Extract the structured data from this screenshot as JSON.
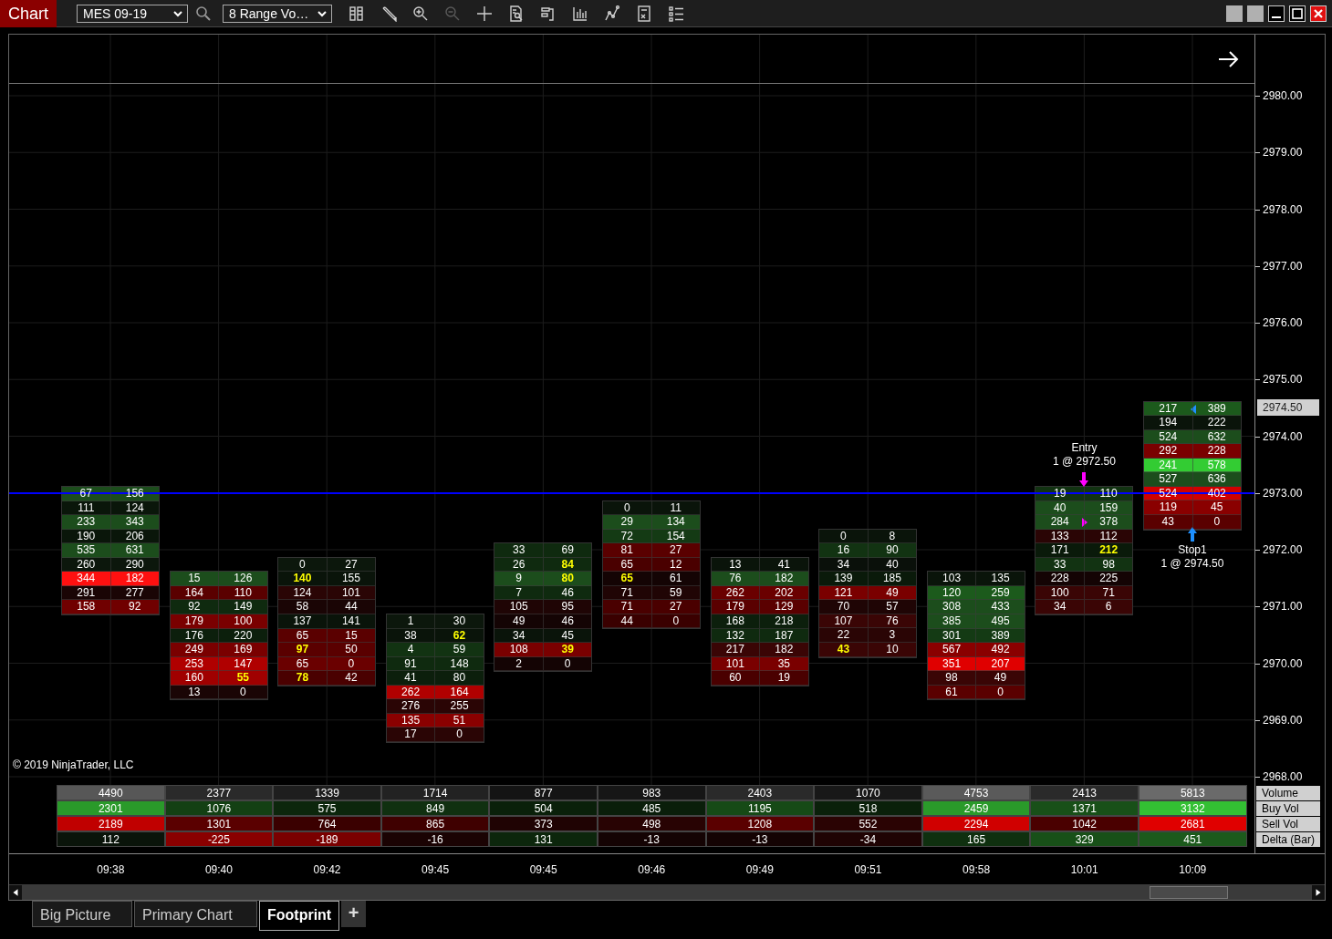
{
  "toolbar": {
    "title": "Chart",
    "instrument": "MES 09-19",
    "interval": "8 Range Vo…",
    "tools": [
      {
        "kind": "columns",
        "disabled": false
      },
      {
        "kind": "pencil",
        "disabled": false
      },
      {
        "kind": "zoom-in",
        "disabled": false
      },
      {
        "kind": "zoom-out",
        "disabled": true
      },
      {
        "kind": "crosshair",
        "disabled": false
      },
      {
        "kind": "doc-search",
        "disabled": false
      },
      {
        "kind": "bracket",
        "disabled": false
      },
      {
        "kind": "bars",
        "disabled": false
      },
      {
        "kind": "line",
        "disabled": false
      },
      {
        "kind": "calc",
        "disabled": false
      },
      {
        "kind": "list",
        "disabled": false
      }
    ]
  },
  "price_axis": {
    "labels": [
      "2980.00",
      "2979.00",
      "2978.00",
      "2977.00",
      "2976.00",
      "2975.00",
      "2974.00",
      "2973.00",
      "2972.00",
      "2971.00",
      "2970.00",
      "2969.00",
      "2968.00"
    ],
    "current": "2974.50"
  },
  "bars": [
    {
      "rows": [
        {
          "bid": "67",
          "ask": "156",
          "color": "#1c4d1c",
          "bid_imbalance": false,
          "ask_imbalance": false
        },
        {
          "bid": "111",
          "ask": "124",
          "color": "#0a160a",
          "bid_imbalance": false,
          "ask_imbalance": false
        },
        {
          "bid": "233",
          "ask": "343",
          "color": "#1c4d1c",
          "bid_imbalance": false,
          "ask_imbalance": false
        },
        {
          "bid": "190",
          "ask": "206",
          "color": "#0a160a",
          "bid_imbalance": false,
          "ask_imbalance": false
        },
        {
          "bid": "535",
          "ask": "631",
          "color": "#1c4d1c",
          "bid_imbalance": false,
          "ask_imbalance": false
        },
        {
          "bid": "260",
          "ask": "290",
          "color": "#0c170c",
          "bid_imbalance": false,
          "ask_imbalance": false
        },
        {
          "bid": "344",
          "ask": "182",
          "color": "#ff1010",
          "bid_imbalance": false,
          "ask_imbalance": false
        },
        {
          "bid": "291",
          "ask": "277",
          "color": "#1a0505",
          "bid_imbalance": false,
          "ask_imbalance": false
        },
        {
          "bid": "158",
          "ask": "92",
          "color": "#700000",
          "bid_imbalance": false,
          "ask_imbalance": false
        }
      ]
    },
    {
      "rows": [
        {
          "bid": "15",
          "ask": "126",
          "color": "#1c4d1c",
          "bid_imbalance": false,
          "ask_imbalance": false
        },
        {
          "bid": "164",
          "ask": "110",
          "color": "#5a0000",
          "bid_imbalance": false,
          "ask_imbalance": false
        },
        {
          "bid": "92",
          "ask": "149",
          "color": "#0f2a0f",
          "bid_imbalance": false,
          "ask_imbalance": false
        },
        {
          "bid": "179",
          "ask": "100",
          "color": "#7a0000",
          "bid_imbalance": false,
          "ask_imbalance": false
        },
        {
          "bid": "176",
          "ask": "220",
          "color": "#0c1f0c",
          "bid_imbalance": false,
          "ask_imbalance": false
        },
        {
          "bid": "249",
          "ask": "169",
          "color": "#7a0000",
          "bid_imbalance": false,
          "ask_imbalance": false
        },
        {
          "bid": "253",
          "ask": "147",
          "color": "#b00000",
          "bid_imbalance": false,
          "ask_imbalance": false
        },
        {
          "bid": "160",
          "ask": "55",
          "color": "#a00000",
          "bid_imbalance": false,
          "ask_imbalance": true
        },
        {
          "bid": "13",
          "ask": "0",
          "color": "#1a0505",
          "bid_imbalance": false,
          "ask_imbalance": false
        }
      ]
    },
    {
      "rows": [
        {
          "bid": "0",
          "ask": "27",
          "color": "#0c170c",
          "bid_imbalance": false,
          "ask_imbalance": false
        },
        {
          "bid": "140",
          "ask": "155",
          "color": "#0a140a",
          "bid_imbalance": true,
          "ask_imbalance": false
        },
        {
          "bid": "124",
          "ask": "101",
          "color": "#2a0505",
          "bid_imbalance": false,
          "ask_imbalance": false
        },
        {
          "bid": "58",
          "ask": "44",
          "color": "#1a0505",
          "bid_imbalance": false,
          "ask_imbalance": false
        },
        {
          "bid": "137",
          "ask": "141",
          "color": "#0a140a",
          "bid_imbalance": false,
          "ask_imbalance": false
        },
        {
          "bid": "65",
          "ask": "15",
          "color": "#5a0000",
          "bid_imbalance": false,
          "ask_imbalance": false
        },
        {
          "bid": "97",
          "ask": "50",
          "color": "#5a0000",
          "bid_imbalance": true,
          "ask_imbalance": false
        },
        {
          "bid": "65",
          "ask": "0",
          "color": "#6a0000",
          "bid_imbalance": false,
          "ask_imbalance": false
        },
        {
          "bid": "78",
          "ask": "42",
          "color": "#4a0000",
          "bid_imbalance": true,
          "ask_imbalance": false
        }
      ]
    },
    {
      "rows": [
        {
          "bid": "1",
          "ask": "30",
          "color": "#0c170c",
          "bid_imbalance": false,
          "ask_imbalance": false
        },
        {
          "bid": "38",
          "ask": "62",
          "color": "#0a140a",
          "bid_imbalance": false,
          "ask_imbalance": true
        },
        {
          "bid": "4",
          "ask": "59",
          "color": "#123312",
          "bid_imbalance": false,
          "ask_imbalance": false
        },
        {
          "bid": "91",
          "ask": "148",
          "color": "#0f2a0f",
          "bid_imbalance": false,
          "ask_imbalance": false
        },
        {
          "bid": "41",
          "ask": "80",
          "color": "#0c1f0c",
          "bid_imbalance": false,
          "ask_imbalance": false
        },
        {
          "bid": "262",
          "ask": "164",
          "color": "#b00000",
          "bid_imbalance": false,
          "ask_imbalance": false
        },
        {
          "bid": "276",
          "ask": "255",
          "color": "#2a0505",
          "bid_imbalance": false,
          "ask_imbalance": false
        },
        {
          "bid": "135",
          "ask": "51",
          "color": "#8a0000",
          "bid_imbalance": false,
          "ask_imbalance": false
        },
        {
          "bid": "17",
          "ask": "0",
          "color": "#2a0505",
          "bid_imbalance": false,
          "ask_imbalance": false
        }
      ]
    },
    {
      "rows": [
        {
          "bid": "33",
          "ask": "69",
          "color": "#0f2a0f",
          "bid_imbalance": false,
          "ask_imbalance": false
        },
        {
          "bid": "26",
          "ask": "84",
          "color": "#0f2a0f",
          "bid_imbalance": false,
          "ask_imbalance": true
        },
        {
          "bid": "9",
          "ask": "80",
          "color": "#1c4d1c",
          "bid_imbalance": false,
          "ask_imbalance": true
        },
        {
          "bid": "7",
          "ask": "46",
          "color": "#0f2a0f",
          "bid_imbalance": false,
          "ask_imbalance": false
        },
        {
          "bid": "105",
          "ask": "95",
          "color": "#1f0505",
          "bid_imbalance": false,
          "ask_imbalance": false
        },
        {
          "bid": "49",
          "ask": "46",
          "color": "#140404",
          "bid_imbalance": false,
          "ask_imbalance": false
        },
        {
          "bid": "34",
          "ask": "45",
          "color": "#0a140a",
          "bid_imbalance": false,
          "ask_imbalance": false
        },
        {
          "bid": "108",
          "ask": "39",
          "color": "#7a0000",
          "bid_imbalance": false,
          "ask_imbalance": true
        },
        {
          "bid": "2",
          "ask": "0",
          "color": "#140404",
          "bid_imbalance": false,
          "ask_imbalance": false
        }
      ]
    },
    {
      "rows": [
        {
          "bid": "0",
          "ask": "11",
          "color": "#0a140a",
          "bid_imbalance": false,
          "ask_imbalance": false
        },
        {
          "bid": "29",
          "ask": "134",
          "color": "#1c4d1c",
          "bid_imbalance": false,
          "ask_imbalance": false
        },
        {
          "bid": "72",
          "ask": "154",
          "color": "#143a14",
          "bid_imbalance": false,
          "ask_imbalance": false
        },
        {
          "bid": "81",
          "ask": "27",
          "color": "#5a0000",
          "bid_imbalance": false,
          "ask_imbalance": false
        },
        {
          "bid": "65",
          "ask": "12",
          "color": "#4a0000",
          "bid_imbalance": false,
          "ask_imbalance": false
        },
        {
          "bid": "65",
          "ask": "61",
          "color": "#140404",
          "bid_imbalance": true,
          "ask_imbalance": false
        },
        {
          "bid": "71",
          "ask": "59",
          "color": "#200505",
          "bid_imbalance": false,
          "ask_imbalance": false
        },
        {
          "bid": "71",
          "ask": "27",
          "color": "#4a0000",
          "bid_imbalance": false,
          "ask_imbalance": false
        },
        {
          "bid": "44",
          "ask": "0",
          "color": "#3a0000",
          "bid_imbalance": false,
          "ask_imbalance": false
        }
      ]
    },
    {
      "rows": [
        {
          "bid": "13",
          "ask": "41",
          "color": "#0a140a",
          "bid_imbalance": false,
          "ask_imbalance": false
        },
        {
          "bid": "76",
          "ask": "182",
          "color": "#1c4d1c",
          "bid_imbalance": false,
          "ask_imbalance": false
        },
        {
          "bid": "262",
          "ask": "202",
          "color": "#6a0000",
          "bid_imbalance": false,
          "ask_imbalance": false
        },
        {
          "bid": "179",
          "ask": "129",
          "color": "#5a0000",
          "bid_imbalance": false,
          "ask_imbalance": false
        },
        {
          "bid": "168",
          "ask": "218",
          "color": "#0c1f0c",
          "bid_imbalance": false,
          "ask_imbalance": false
        },
        {
          "bid": "132",
          "ask": "187",
          "color": "#0f2a0f",
          "bid_imbalance": false,
          "ask_imbalance": false
        },
        {
          "bid": "217",
          "ask": "182",
          "color": "#3a0505",
          "bid_imbalance": false,
          "ask_imbalance": false
        },
        {
          "bid": "101",
          "ask": "35",
          "color": "#7a0000",
          "bid_imbalance": false,
          "ask_imbalance": false
        },
        {
          "bid": "60",
          "ask": "19",
          "color": "#4a0000",
          "bid_imbalance": false,
          "ask_imbalance": false
        }
      ]
    },
    {
      "rows": [
        {
          "bid": "0",
          "ask": "8",
          "color": "#0a140a",
          "bid_imbalance": false,
          "ask_imbalance": false
        },
        {
          "bid": "16",
          "ask": "90",
          "color": "#123312",
          "bid_imbalance": false,
          "ask_imbalance": false
        },
        {
          "bid": "34",
          "ask": "40",
          "color": "#0a100a",
          "bid_imbalance": false,
          "ask_imbalance": false
        },
        {
          "bid": "139",
          "ask": "185",
          "color": "#0a1a0a",
          "bid_imbalance": false,
          "ask_imbalance": false
        },
        {
          "bid": "121",
          "ask": "49",
          "color": "#7a0000",
          "bid_imbalance": false,
          "ask_imbalance": false
        },
        {
          "bid": "70",
          "ask": "57",
          "color": "#1f0505",
          "bid_imbalance": false,
          "ask_imbalance": false
        },
        {
          "bid": "107",
          "ask": "76",
          "color": "#3a0505",
          "bid_imbalance": false,
          "ask_imbalance": false
        },
        {
          "bid": "22",
          "ask": "3",
          "color": "#2a0505",
          "bid_imbalance": false,
          "ask_imbalance": false
        },
        {
          "bid": "43",
          "ask": "10",
          "color": "#3a0505",
          "bid_imbalance": true,
          "ask_imbalance": false
        }
      ]
    },
    {
      "rows": [
        {
          "bid": "103",
          "ask": "135",
          "color": "#0a140a",
          "bid_imbalance": false,
          "ask_imbalance": false
        },
        {
          "bid": "120",
          "ask": "259",
          "color": "#1c5a1c",
          "bid_imbalance": false,
          "ask_imbalance": false
        },
        {
          "bid": "308",
          "ask": "433",
          "color": "#1c4d1c",
          "bid_imbalance": false,
          "ask_imbalance": false
        },
        {
          "bid": "385",
          "ask": "495",
          "color": "#1c4d1c",
          "bid_imbalance": false,
          "ask_imbalance": false
        },
        {
          "bid": "301",
          "ask": "389",
          "color": "#143a14",
          "bid_imbalance": false,
          "ask_imbalance": false
        },
        {
          "bid": "567",
          "ask": "492",
          "color": "#8a0000",
          "bid_imbalance": false,
          "ask_imbalance": false
        },
        {
          "bid": "351",
          "ask": "207",
          "color": "#e00000",
          "bid_imbalance": false,
          "ask_imbalance": false
        },
        {
          "bid": "98",
          "ask": "49",
          "color": "#3a0505",
          "bid_imbalance": false,
          "ask_imbalance": false
        },
        {
          "bid": "61",
          "ask": "0",
          "color": "#5a0000",
          "bid_imbalance": false,
          "ask_imbalance": false
        }
      ]
    },
    {
      "order": {
        "kind": "entry",
        "label": "Entry",
        "detail": "1 @ 2972.50"
      },
      "rows": [
        {
          "bid": "19",
          "ask": "110",
          "color": "#123312",
          "bid_imbalance": false,
          "ask_imbalance": false
        },
        {
          "bid": "40",
          "ask": "159",
          "color": "#1c4d1c",
          "bid_imbalance": false,
          "ask_imbalance": false
        },
        {
          "bid": "284",
          "ask": "378",
          "color": "#1c4d1c",
          "bid_imbalance": false,
          "ask_imbalance": false
        },
        {
          "bid": "133",
          "ask": "112",
          "color": "#2a0505",
          "bid_imbalance": false,
          "ask_imbalance": false
        },
        {
          "bid": "171",
          "ask": "212",
          "color": "#0a1a0a",
          "bid_imbalance": false,
          "ask_imbalance": true
        },
        {
          "bid": "33",
          "ask": "98",
          "color": "#123312",
          "bid_imbalance": false,
          "ask_imbalance": false
        },
        {
          "bid": "228",
          "ask": "225",
          "color": "#140404",
          "bid_imbalance": false,
          "ask_imbalance": false
        },
        {
          "bid": "100",
          "ask": "71",
          "color": "#3a0505",
          "bid_imbalance": false,
          "ask_imbalance": false
        },
        {
          "bid": "34",
          "ask": "6",
          "color": "#3a0505",
          "bid_imbalance": false,
          "ask_imbalance": false
        }
      ]
    },
    {
      "order": {
        "kind": "stop",
        "label": "Stop1",
        "detail": "1 @ 2974.50"
      },
      "rows": [
        {
          "bid": "217",
          "ask": "389",
          "color": "#1c5a1c",
          "bid_imbalance": false,
          "ask_imbalance": false
        },
        {
          "bid": "194",
          "ask": "222",
          "color": "#0a140a",
          "bid_imbalance": false,
          "ask_imbalance": false
        },
        {
          "bid": "524",
          "ask": "632",
          "color": "#1c4d1c",
          "bid_imbalance": false,
          "ask_imbalance": false
        },
        {
          "bid": "292",
          "ask": "228",
          "color": "#7a0000",
          "bid_imbalance": false,
          "ask_imbalance": false
        },
        {
          "bid": "241",
          "ask": "578",
          "color": "#33cc33",
          "bid_imbalance": false,
          "ask_imbalance": false
        },
        {
          "bid": "527",
          "ask": "636",
          "color": "#1c4d1c",
          "bid_imbalance": false,
          "ask_imbalance": false
        },
        {
          "bid": "524",
          "ask": "402",
          "color": "#d00000",
          "bid_imbalance": false,
          "ask_imbalance": false
        },
        {
          "bid": "119",
          "ask": "45",
          "color": "#8a0000",
          "bid_imbalance": false,
          "ask_imbalance": false
        },
        {
          "bid": "43",
          "ask": "0",
          "color": "#5a0000",
          "bid_imbalance": false,
          "ask_imbalance": false
        }
      ]
    }
  ],
  "summary": {
    "row_labels": [
      "Volume",
      "Buy Vol",
      "Sell Vol",
      "Delta (Bar)"
    ],
    "rows": [
      [
        {
          "text": "4490",
          "color": "#575757"
        },
        {
          "text": "2377",
          "color": "#2a2a2a"
        },
        {
          "text": "1339",
          "color": "#1e1e1e"
        },
        {
          "text": "1714",
          "color": "#222222"
        },
        {
          "text": "877",
          "color": "#141414"
        },
        {
          "text": "983",
          "color": "#161616"
        },
        {
          "text": "2403",
          "color": "#2a2a2a"
        },
        {
          "text": "1070",
          "color": "#181818"
        },
        {
          "text": "4753",
          "color": "#5a5a5a"
        },
        {
          "text": "2413",
          "color": "#2a2a2a"
        },
        {
          "text": "5813",
          "color": "#6a6a6a"
        }
      ],
      [
        {
          "text": "2301",
          "color": "#2a9a2a"
        },
        {
          "text": "1076",
          "color": "#134013"
        },
        {
          "text": "575",
          "color": "#0c260c"
        },
        {
          "text": "849",
          "color": "#103010"
        },
        {
          "text": "504",
          "color": "#0a200a"
        },
        {
          "text": "485",
          "color": "#0a1e0a"
        },
        {
          "text": "1195",
          "color": "#164a16"
        },
        {
          "text": "518",
          "color": "#0a200a"
        },
        {
          "text": "2459",
          "color": "#2a9a2a"
        },
        {
          "text": "1371",
          "color": "#185018"
        },
        {
          "text": "3132",
          "color": "#33c033"
        }
      ],
      [
        {
          "text": "2189",
          "color": "#c00000"
        },
        {
          "text": "1301",
          "color": "#5a0000"
        },
        {
          "text": "764",
          "color": "#3a0000"
        },
        {
          "text": "865",
          "color": "#3f0000"
        },
        {
          "text": "373",
          "color": "#1f0303"
        },
        {
          "text": "498",
          "color": "#280303"
        },
        {
          "text": "1208",
          "color": "#5a0000"
        },
        {
          "text": "552",
          "color": "#2a0303"
        },
        {
          "text": "2294",
          "color": "#d00000"
        },
        {
          "text": "1042",
          "color": "#4a0000"
        },
        {
          "text": "2681",
          "color": "#e00000"
        }
      ],
      [
        {
          "text": "112",
          "color": "#0a140a"
        },
        {
          "text": "-225",
          "color": "#8a0000"
        },
        {
          "text": "-189",
          "color": "#7a0000"
        },
        {
          "text": "-16",
          "color": "#1a0303"
        },
        {
          "text": "131",
          "color": "#0c260c"
        },
        {
          "text": "-13",
          "color": "#140303"
        },
        {
          "text": "-13",
          "color": "#140303"
        },
        {
          "text": "-34",
          "color": "#1f0303"
        },
        {
          "text": "165",
          "color": "#0f300f"
        },
        {
          "text": "329",
          "color": "#185018"
        },
        {
          "text": "451",
          "color": "#1c5a1c"
        }
      ]
    ]
  },
  "copyright": "© 2019 NinjaTrader, LLC",
  "time_axis": [
    "09:38",
    "09:40",
    "09:42",
    "09:45",
    "09:45",
    "09:46",
    "09:49",
    "09:51",
    "09:58",
    "10:01",
    "10:09"
  ],
  "tabs": [
    {
      "label": "Big Picture",
      "selected": false
    },
    {
      "label": "Primary Chart",
      "selected": false
    },
    {
      "label": "Footprint",
      "selected": true
    }
  ],
  "add_tab": "+"
}
